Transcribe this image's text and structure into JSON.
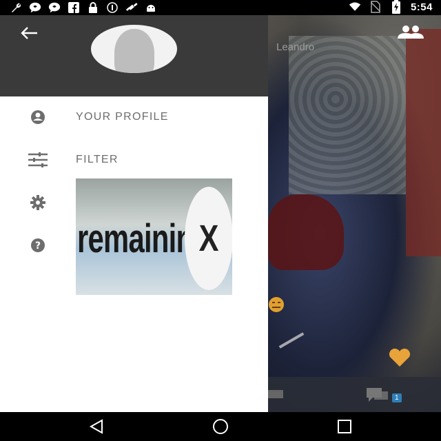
{
  "status_bar": {
    "time": "5:54",
    "left_icons": [
      "wrench-icon",
      "chat-bubble-icon",
      "chat-bubble-icon",
      "facebook-icon",
      "lock-icon",
      "info-circle-icon",
      "satellite-icon",
      "android-icon"
    ],
    "right_icons": [
      "wifi-icon",
      "no-sim-icon",
      "battery-charging-icon"
    ]
  },
  "drawer": {
    "header_color": "#3a3a3a",
    "menu": [
      {
        "label": "YOUR PROFILE",
        "icon": "account-circle-icon"
      },
      {
        "label": "FILTER",
        "icon": "sliders-icon"
      },
      {
        "label": "",
        "icon": "gear-icon"
      },
      {
        "label": "",
        "icon": "help-icon"
      }
    ],
    "ad": {
      "word": "remaining",
      "close_glyph": "X"
    }
  },
  "background": {
    "caller_name": "Leandro",
    "chat_badge": "1",
    "heart_color": "#e8a33a"
  },
  "nav": {
    "icons": [
      "back-triangle-icon",
      "home-circle-icon",
      "recents-square-icon"
    ]
  }
}
